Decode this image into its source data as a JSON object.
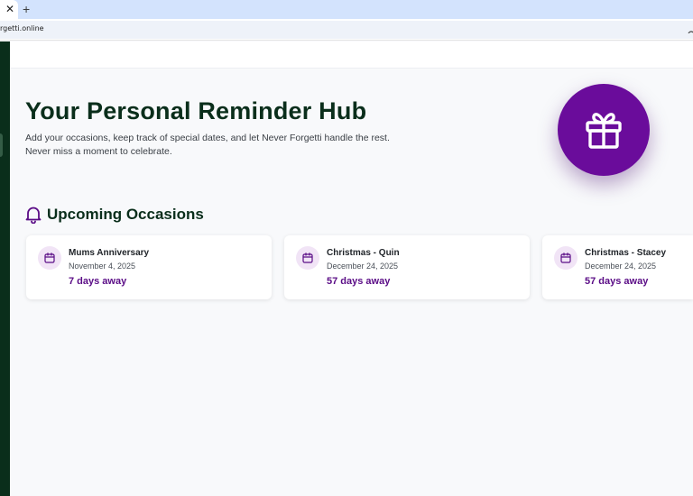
{
  "browser": {
    "tab_close": "✕",
    "new_tab": "+",
    "url": "rgetti.online"
  },
  "hero": {
    "title": "Your Personal Reminder Hub",
    "subtitle": "Add your occasions, keep track of special dates, and let Never Forgetti handle the rest. Never miss a moment to celebrate.",
    "icon": "gift-icon"
  },
  "upcoming": {
    "title": "Upcoming Occasions",
    "icon": "bell-icon",
    "cards": [
      {
        "title": "Mums Anniversary",
        "date": "November 4, 2025",
        "away": "7 days away",
        "icon": "calendar-icon"
      },
      {
        "title": "Christmas - Quin",
        "date": "December 24, 2025",
        "away": "57 days away",
        "icon": "calendar-icon"
      },
      {
        "title": "Christmas - Stacey",
        "date": "December 24, 2025",
        "away": "57 days away",
        "icon": "calendar-icon"
      }
    ]
  },
  "colors": {
    "brand_dark": "#0a2e1b",
    "accent_purple": "#6a0c9b",
    "accent_text": "#5a0c86",
    "background": "#f8f9fb"
  }
}
